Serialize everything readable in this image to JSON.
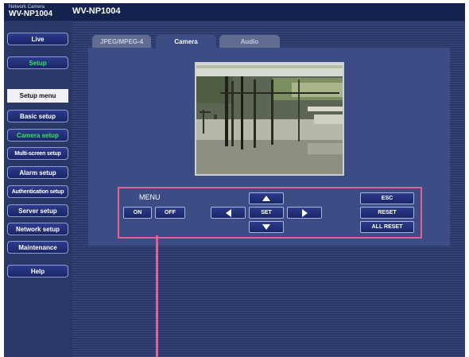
{
  "header": {
    "brand_small": "Network Camera",
    "brand_model": "WV-NP1004",
    "title": "WV-NP1004"
  },
  "sidebar": {
    "live": "Live",
    "setup": "Setup",
    "menu_heading": "Setup menu",
    "items": [
      {
        "label": "Basic setup",
        "active": false
      },
      {
        "label": "Camera setup",
        "active": true
      },
      {
        "label": "Multi-screen setup",
        "active": false
      },
      {
        "label": "Alarm setup",
        "active": false
      },
      {
        "label": "Authentication setup",
        "active": false
      },
      {
        "label": "Server setup",
        "active": false
      },
      {
        "label": "Network setup",
        "active": false
      },
      {
        "label": "Maintenance",
        "active": false
      }
    ],
    "help": "Help"
  },
  "tabs": [
    {
      "label": "JPEG/MPEG-4",
      "active": false
    },
    {
      "label": "Camera",
      "active": true
    },
    {
      "label": "Audio",
      "active": false
    }
  ],
  "menu_control": {
    "label": "MENU",
    "on": "ON",
    "off": "OFF",
    "set": "SET",
    "esc": "ESC",
    "reset": "RESET",
    "all_reset": "ALL RESET",
    "icons": [
      "arrow-up-icon",
      "arrow-down-icon",
      "arrow-left-icon",
      "arrow-right-icon"
    ]
  },
  "colors": {
    "accent_active": "#35e35a",
    "highlight_box": "#e0609a",
    "header_bg": "#14224e",
    "panel_bg": "#3c4c85"
  }
}
